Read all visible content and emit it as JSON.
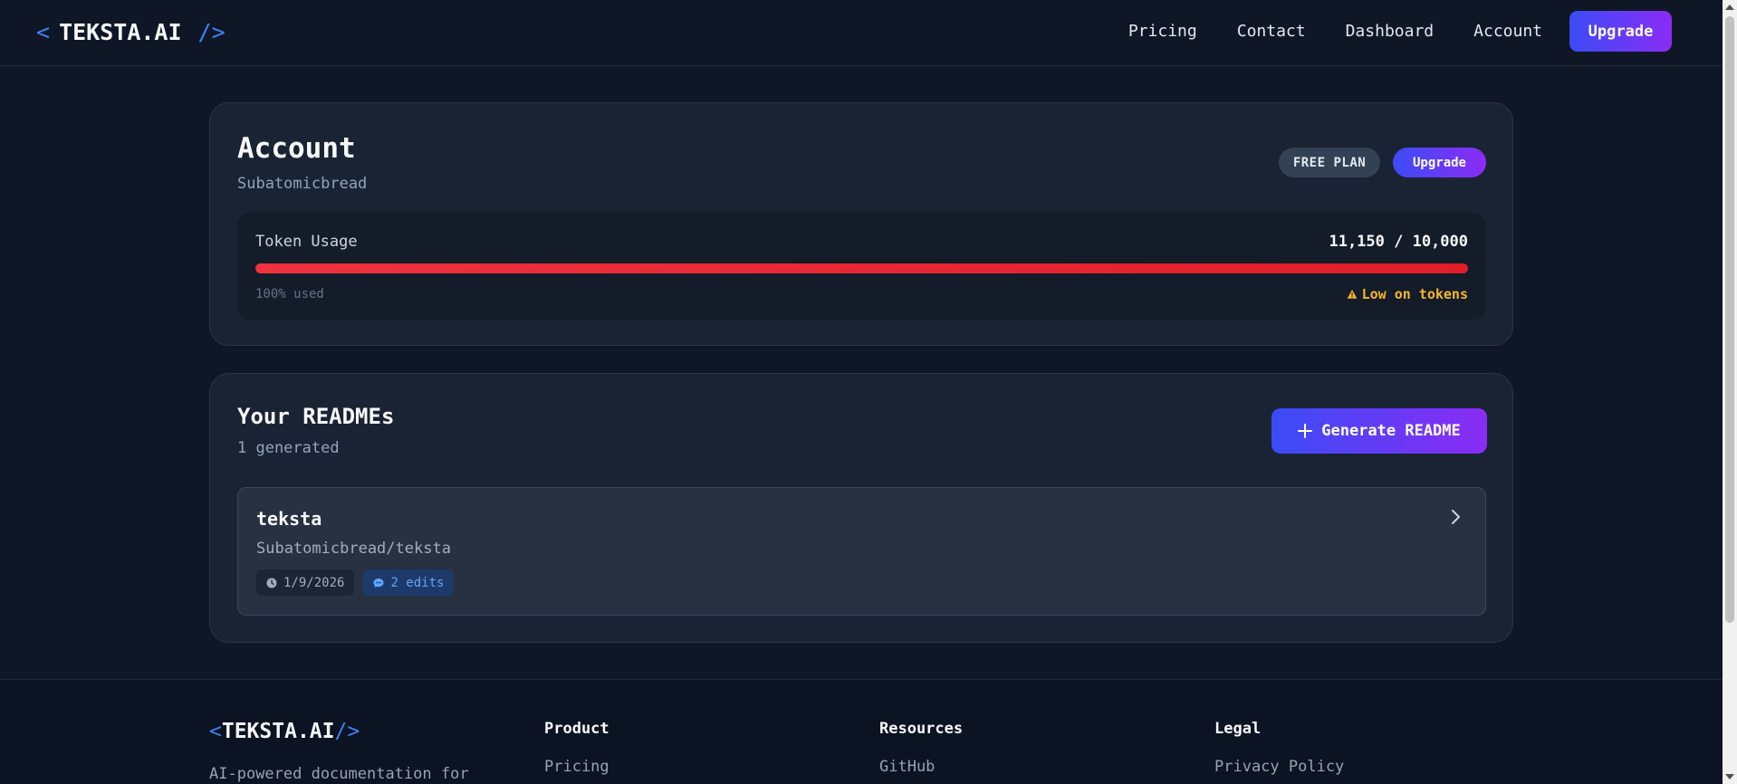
{
  "header": {
    "logo_open": "<",
    "logo_text": "TEKSTA.AI",
    "logo_close": "/>",
    "nav": {
      "pricing": "Pricing",
      "contact": "Contact",
      "dashboard": "Dashboard",
      "account": "Account"
    },
    "upgrade_label": "Upgrade"
  },
  "account": {
    "title": "Account",
    "username": "Subatomicbread",
    "plan_badge": "FREE PLAN",
    "upgrade_label": "Upgrade",
    "usage": {
      "label": "Token Usage",
      "count": "11,150 / 10,000",
      "percent_text": "100% used",
      "fill_fraction": 1.0,
      "warning": "Low on tokens"
    }
  },
  "readmes": {
    "title": "Your READMEs",
    "subtitle": "1 generated",
    "generate_label": "Generate README",
    "items": [
      {
        "name": "teksta",
        "repo": "Subatomicbread/teksta",
        "date": "1/9/2026",
        "edits": "2 edits"
      }
    ]
  },
  "footer": {
    "logo_open": "<",
    "logo_text": "TEKSTA.AI",
    "logo_close": "/>",
    "description": "AI-powered documentation for",
    "columns": [
      {
        "heading": "Product",
        "link": "Pricing"
      },
      {
        "heading": "Resources",
        "link": "GitHub"
      },
      {
        "heading": "Legal",
        "link": "Privacy Policy"
      }
    ]
  },
  "colors": {
    "background": "#0f1726",
    "card": "#1a2333",
    "accent_start": "#3b4cf6",
    "accent_end": "#8b2cf5",
    "usage_bar": "#e11d2a",
    "warning": "#f5b829"
  }
}
